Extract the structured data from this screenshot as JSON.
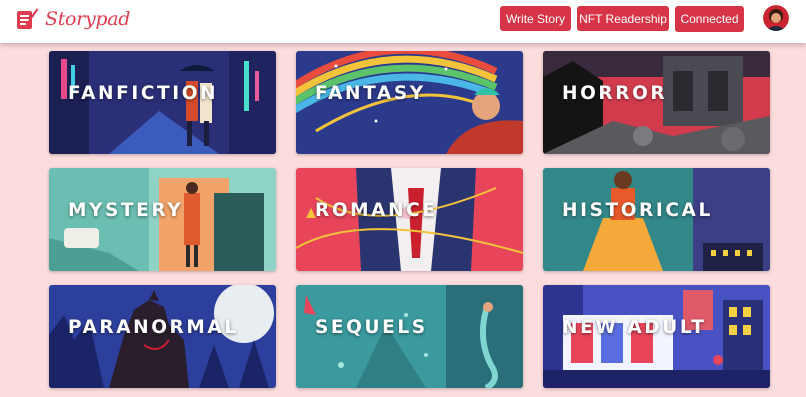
{
  "brand": {
    "name": "Storypad",
    "icon": "book-quill-icon"
  },
  "nav": {
    "write_story": "Write Story",
    "nft_readership": "NFT Readership",
    "connected": "Connected",
    "avatar_icon": "user-avatar-icon"
  },
  "colors": {
    "accent": "#d83447",
    "page_bg": "#fcdcdc",
    "brand_text": "#e03c4f"
  },
  "genres": [
    {
      "label": "FANFICTION",
      "icon": "city-couple-umbrella-illustration"
    },
    {
      "label": "FANTASY",
      "icon": "rainbow-wand-illustration"
    },
    {
      "label": "HORROR",
      "icon": "haunted-ruins-illustration"
    },
    {
      "label": "MYSTERY",
      "icon": "detective-trenchcoat-illustration"
    },
    {
      "label": "ROMANCE",
      "icon": "suit-rose-illustration"
    },
    {
      "label": "HISTORICAL",
      "icon": "woman-yellow-gown-illustration"
    },
    {
      "label": "PARANORMAL",
      "icon": "werewolf-moon-illustration"
    },
    {
      "label": "SEQUELS",
      "icon": "mermaid-underwater-illustration"
    },
    {
      "label": "NEW ADULT",
      "icon": "neon-street-illustration"
    }
  ]
}
